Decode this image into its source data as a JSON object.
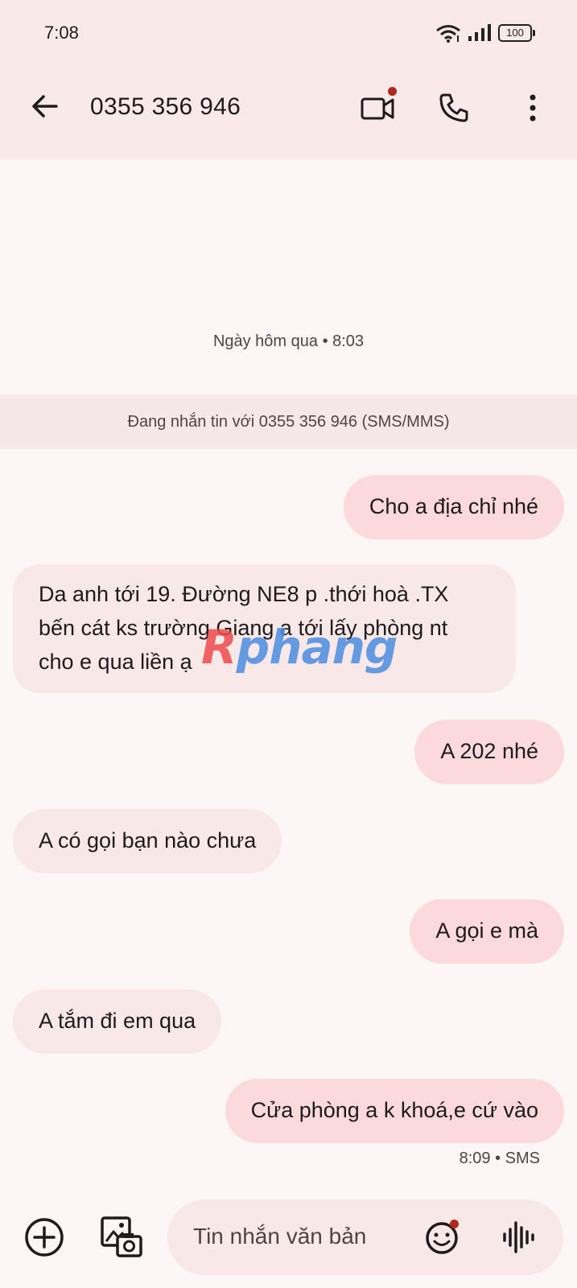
{
  "status_bar": {
    "time": "7:08",
    "battery": "100"
  },
  "header": {
    "back_icon": "arrow-left-icon",
    "title": "0355 356 946",
    "video_icon": "video-camera-icon",
    "call_icon": "phone-icon",
    "more_icon": "more-vertical-icon"
  },
  "conversation": {
    "date_label": "Ngày hôm qua • 8:03",
    "banner": "Đang nhắn tin với 0355 356 946 (SMS/MMS)",
    "messages": [
      {
        "direction": "outgoing",
        "text": "Cho a địa chỉ nhé"
      },
      {
        "direction": "incoming",
        "lines": [
          "Da anh tới 19. Đường NE8  p .thới hoà .TX",
          "bến cát ks trường Giang a tới lấy phòng nt",
          "cho e qua liền ạ"
        ]
      },
      {
        "direction": "outgoing",
        "text": "A 202 nhé"
      },
      {
        "direction": "incoming",
        "text": "A có gọi bạn nào chưa"
      },
      {
        "direction": "outgoing",
        "text": "A gọi e mà"
      },
      {
        "direction": "incoming",
        "text": "A tắm đi em qua"
      },
      {
        "direction": "outgoing",
        "text": "Cửa phòng a k khoá,e cứ vào"
      }
    ],
    "last_meta": "8:09 • SMS"
  },
  "watermark": {
    "part1": "R",
    "part2": "phang"
  },
  "composer": {
    "placeholder": "Tin nhắn văn bản",
    "add_icon": "plus-circle-icon",
    "gallery_icon": "gallery-camera-icon",
    "emoji_icon": "emoji-icon",
    "voice_icon": "voice-waveform-icon"
  },
  "colors": {
    "header_bg": "#f9e9e9",
    "outgoing_bubble": "#fbd9dc",
    "incoming_bubble": "#f8e8e8",
    "notification_dot": "#b3261e"
  }
}
